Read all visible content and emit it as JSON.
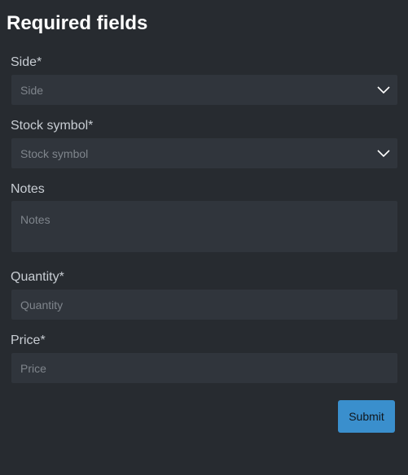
{
  "form": {
    "title": "Required fields",
    "side": {
      "label": "Side*",
      "placeholder": "Side",
      "icon": "chevron-down-icon"
    },
    "stock_symbol": {
      "label": "Stock symbol*",
      "placeholder": "Stock symbol",
      "icon": "chevron-down-icon"
    },
    "notes": {
      "label": "Notes",
      "placeholder": "Notes"
    },
    "quantity": {
      "label": "Quantity*",
      "placeholder": "Quantity"
    },
    "price": {
      "label": "Price*",
      "placeholder": "Price"
    },
    "submit_label": "Submit"
  },
  "colors": {
    "background": "#272b30",
    "field_background": "#30353c",
    "label_text": "#c8cdd3",
    "placeholder_text": "#7f858c",
    "title_text": "#ffffff",
    "accent": "#3a8fcd"
  }
}
